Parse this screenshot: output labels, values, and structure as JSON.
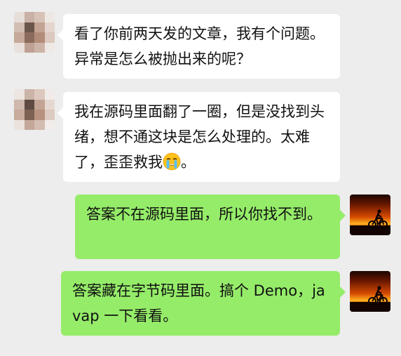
{
  "messages": [
    {
      "sender": "other",
      "text": "看了你前两天发的文章，我有个问题。异常是怎么被抛出来的呢？"
    },
    {
      "sender": "other",
      "text": "我在源码里面翻了一圈，但是没找到头绪，想不通这块是怎么处理的。太难了，歪歪救我",
      "emoji": "crying-face-emoji",
      "text_after": "。"
    },
    {
      "sender": "self",
      "text": "答案不在源码里面，所以你找不到。"
    },
    {
      "sender": "self",
      "text": "答案藏在字节码里面。搞个 Demo，javap 一下看看。"
    }
  ],
  "colors": {
    "background": "#ededed",
    "bubble_other": "#ffffff",
    "bubble_self": "#95ec69",
    "text": "#111111"
  }
}
